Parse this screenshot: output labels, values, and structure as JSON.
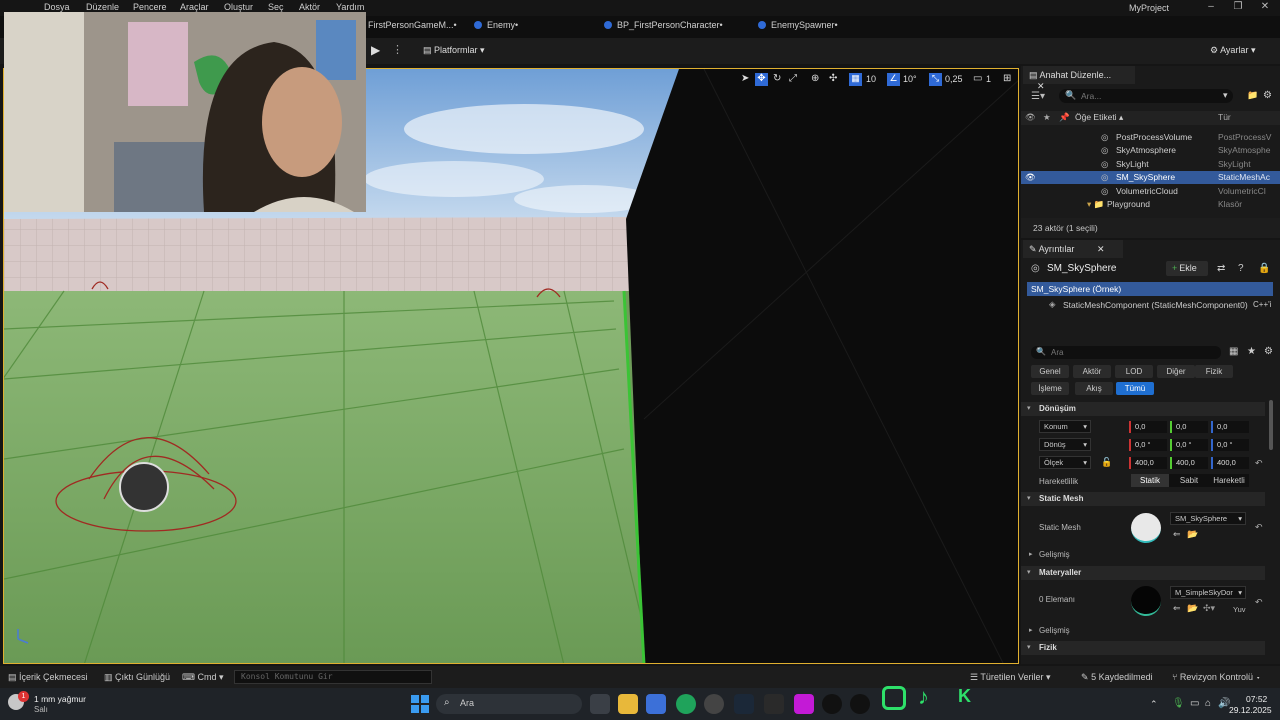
{
  "menu": [
    "Dosya",
    "Düzenle",
    "Pencere",
    "Araçlar",
    "Oluştur",
    "Seç",
    "Aktör",
    "Yardım"
  ],
  "project_name": "MyProject",
  "tabs": [
    {
      "label": "FirstPersonGameM...•"
    },
    {
      "label": "Enemy•"
    },
    {
      "label": "BP_FirstPersonCharacter•"
    },
    {
      "label": "EnemySpawner•"
    }
  ],
  "toolbar": {
    "platforms": "Platformlar",
    "settings": "Ayarlar"
  },
  "viewport": {
    "grid_snap": "10",
    "rotation_snap": "10°",
    "scale_snap": "0,25",
    "camera_speed": "1"
  },
  "outliner": {
    "tab": "Anahat Düzenle...",
    "search_placeholder": "Ara...",
    "col_label": "Öğe Etiketi",
    "col_type": "Tür",
    "rows": [
      {
        "label": "PostProcessVolume",
        "type": "PostProcessV",
        "selected": false,
        "indent": 1
      },
      {
        "label": "SkyAtmosphere",
        "type": "SkyAtmosphe",
        "selected": false,
        "indent": 1
      },
      {
        "label": "SkyLight",
        "type": "SkyLight",
        "selected": false,
        "indent": 1
      },
      {
        "label": "SM_SkySphere",
        "type": "StaticMeshAc",
        "selected": true,
        "indent": 1
      },
      {
        "label": "VolumetricCloud",
        "type": "VolumetricCl",
        "selected": false,
        "indent": 1
      },
      {
        "label": "Playground",
        "type": "Klasör",
        "selected": false,
        "indent": 0
      }
    ],
    "footer": "23 aktör (1 seçili)"
  },
  "details": {
    "tab": "Ayrıntılar",
    "actor": "SM_SkySphere",
    "add_label": "Ekle",
    "instance": "SM_SkySphere (Örnek)",
    "component": "StaticMeshComponent (StaticMeshComponent0)",
    "cpp": "C++'i",
    "search_placeholder": "Ara",
    "categories_row1": [
      "Genel",
      "Aktör",
      "LOD",
      "Diğer",
      "Fizik"
    ],
    "categories_row2": [
      "İşleme",
      "Akış",
      "Tümü"
    ],
    "transform": {
      "header": "Dönüşüm",
      "location_label": "Konum",
      "rotation_label": "Dönüş",
      "scale_label": "Ölçek",
      "location": [
        "0,0",
        "0,0",
        "0,0"
      ],
      "rotation": [
        "0,0 °",
        "0,0 °",
        "0,0 °"
      ],
      "scale": [
        "400,0",
        "400,0",
        "400,0"
      ],
      "mobility_label": "Hareketlilik",
      "mobility_options": [
        "Statik",
        "Sabit",
        "Hareketli"
      ]
    },
    "static_mesh": {
      "header": "Static Mesh",
      "label": "Static Mesh",
      "value": "SM_SkySphere",
      "advanced": "Gelişmiş"
    },
    "materials": {
      "header": "Materyaller",
      "element": "0 Elemanı",
      "value": "M_SimpleSkyDor",
      "extra": "Yuv",
      "advanced": "Gelişmiş"
    },
    "physics_header": "Fizik"
  },
  "statusbar": {
    "content_drawer": "İçerik Çekmecesi",
    "output_log": "Çıktı Günlüğü",
    "cmd": "Cmd",
    "console_placeholder": "Konsol Komutunu Gir",
    "derived_data": "Türetilen Veriler",
    "unsaved": "5 Kaydedilmedi",
    "revision": "Revizyon Kontrolü"
  },
  "taskbar": {
    "weather_line1": "1 mm yağmur",
    "weather_line2": "Salı",
    "weather_badge": "1",
    "search": "Ara",
    "time": "07:52",
    "date": "29.12.2025"
  }
}
